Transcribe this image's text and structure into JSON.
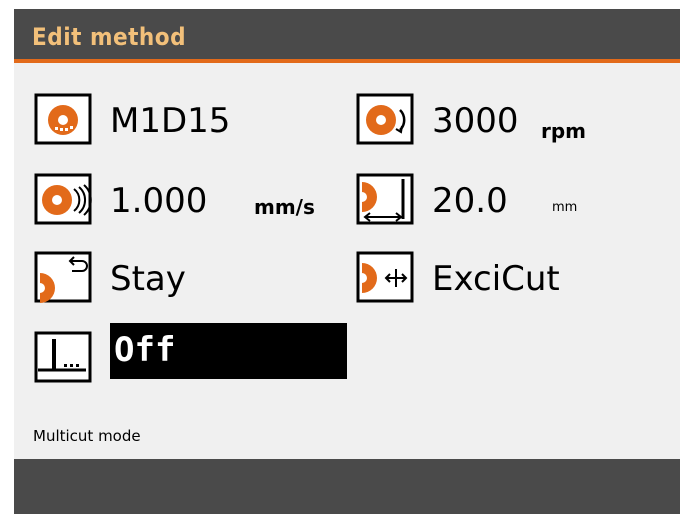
{
  "window": {
    "title": "Edit method"
  },
  "fields": {
    "name": {
      "value": "M1D15",
      "icon": "wheel-icon"
    },
    "speed": {
      "value": "3000",
      "unit": "rpm",
      "icon": "wheel-rotation-icon"
    },
    "feed": {
      "value": "1.000",
      "unit": "mm/s",
      "icon": "feed-rate-icon"
    },
    "length": {
      "value": "20.0",
      "unit": "mm",
      "icon": "cut-length-icon"
    },
    "end_position": {
      "value": "Stay",
      "icon": "return-position-icon"
    },
    "cut_mode": {
      "value": "ExciCut",
      "icon": "exci-cut-icon"
    },
    "multicut": {
      "value": "Off",
      "icon": "multicut-icon"
    }
  },
  "help": {
    "text": "Multicut mode"
  },
  "colors": {
    "accent": "#e26a1a",
    "title_text": "#f2c07a",
    "frame": "#4a4a4a",
    "panel": "#f0f0f0",
    "selection": "#000000"
  }
}
